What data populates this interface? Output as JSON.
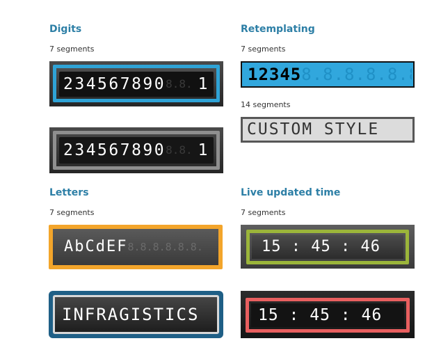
{
  "sections": {
    "digits": {
      "title": "Digits",
      "subtitle": "7 segments"
    },
    "retemplating": {
      "title": "Retemplating",
      "subtitle_7": "7 segments",
      "subtitle_14": "14 segments"
    },
    "letters": {
      "title": "Letters",
      "subtitle": "7 segments"
    },
    "live_time": {
      "title": "Live updated time",
      "subtitle": "7 segments"
    }
  },
  "displays": {
    "digits_1": {
      "lit": "234567890",
      "off": "8.8.",
      "tail": "1",
      "lit_color": "#ffffff",
      "off_color": "#3a3a3a"
    },
    "digits_2": {
      "lit": "234567890",
      "off": "8.8.",
      "tail": "1",
      "lit_color": "#ffffff",
      "off_color": "#3a3a3a"
    },
    "retemp_1": {
      "lit": "12345",
      "off": "8.8.8.8.8.8.",
      "lit_color": "#000000",
      "off_color": "#1f90c6"
    },
    "retemp_2": {
      "lit": "CUSTOM STYLE",
      "off": "",
      "lit_color": "#333333",
      "off_color": "#c4c4c4"
    },
    "letters_1": {
      "lit": "AbCdEF",
      "off": "8.8.8.8.8.8.",
      "lit_color": "#ffffff",
      "off_color": "#6a6a6a"
    },
    "letters_2": {
      "lit": "INFRAGISTICS",
      "off": "",
      "lit_color": "#ffffff",
      "off_color": "#3d3d3d"
    },
    "time_1": {
      "lit": "15 : 45 : 46",
      "off": "",
      "lit_color": "#ffffff",
      "off_color": "#5d5d5d"
    },
    "time_2": {
      "lit": "15 : 45 : 46",
      "off": "",
      "lit_color": "#ffffff",
      "off_color": "#3a3a3a"
    }
  }
}
